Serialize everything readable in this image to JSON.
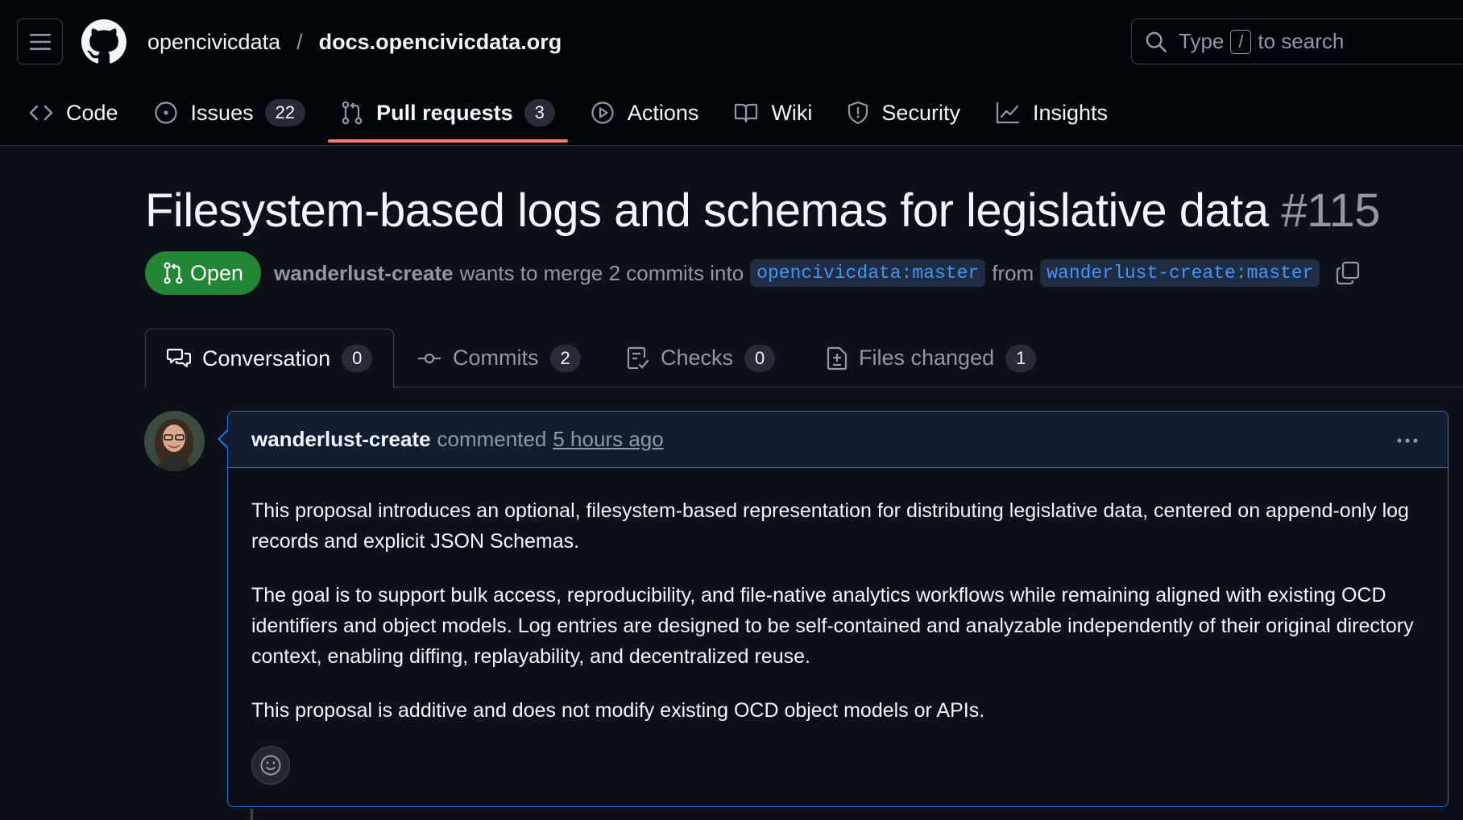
{
  "header": {
    "owner": "opencivicdata",
    "separator": "/",
    "repo": "docs.opencivicdata.org",
    "search": {
      "prefix": "Type",
      "key": "/",
      "suffix": "to search"
    }
  },
  "repo_nav": {
    "code": "Code",
    "issues": "Issues",
    "issues_count": "22",
    "pull_requests": "Pull requests",
    "pull_requests_count": "3",
    "actions": "Actions",
    "wiki": "Wiki",
    "security": "Security",
    "insights": "Insights"
  },
  "pr": {
    "title": "Filesystem-based logs and schemas for legislative data",
    "number": "#115",
    "state": "Open",
    "author": "wanderlust-create",
    "merge_text": "wants to merge 2 commits into",
    "base_branch": "opencivicdata:master",
    "from_text": "from",
    "head_branch": "wanderlust-create:master"
  },
  "pr_tabs": {
    "conversation": "Conversation",
    "conversation_count": "0",
    "commits": "Commits",
    "commits_count": "2",
    "checks": "Checks",
    "checks_count": "0",
    "files_changed": "Files changed",
    "files_changed_count": "1"
  },
  "comment": {
    "author": "wanderlust-create",
    "action": "commented",
    "time": "5 hours ago",
    "paragraphs": [
      "This proposal introduces an optional, filesystem-based representation for distributing legislative data, centered on append-only log records and explicit JSON Schemas.",
      "The goal is to support bulk access, reproducibility, and file-native analytics workflows while remaining aligned with existing OCD identifiers and object models. Log entries are designed to be self-contained and analyzable independently of their original directory context, enabling diffing, replayability, and decentralized reuse.",
      "This proposal is additive and does not modify existing OCD object models or APIs."
    ]
  },
  "colors": {
    "background": "#0d1117",
    "header_bg": "#010409",
    "open_green": "#238636",
    "active_tab_underline": "#f78166",
    "link_blue": "#4493f8",
    "comment_border": "#1f6feb"
  }
}
